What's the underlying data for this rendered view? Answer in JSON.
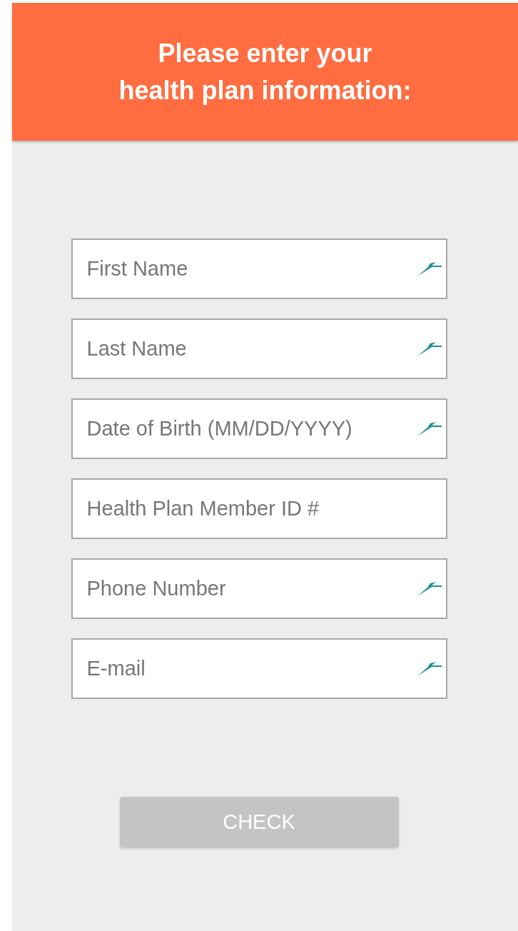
{
  "header": {
    "title_lines": [
      "Please enter your",
      "health plan information:"
    ]
  },
  "fields": [
    {
      "placeholder": "First Name",
      "autofill_icon": true
    },
    {
      "placeholder": "Last Name",
      "autofill_icon": true
    },
    {
      "placeholder": "Date of Birth (MM/DD/YYYY)",
      "autofill_icon": true
    },
    {
      "placeholder": "Health Plan Member ID #",
      "autofill_icon": false
    },
    {
      "placeholder": "Phone Number",
      "autofill_icon": true
    },
    {
      "placeholder": "E-mail",
      "autofill_icon": true
    }
  ],
  "button": {
    "label": "CHECK",
    "disabled": true
  }
}
